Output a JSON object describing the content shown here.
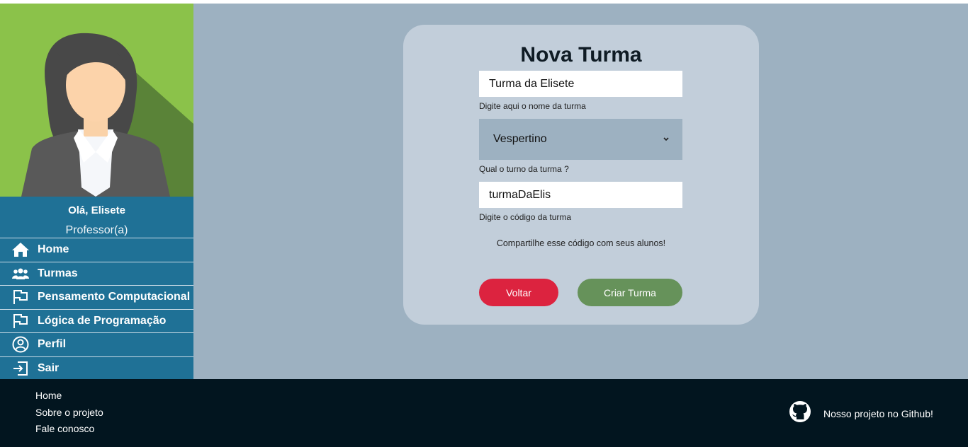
{
  "sidebar": {
    "greeting": "Olá, Elisete",
    "role": "Professor(a)",
    "items": [
      {
        "label": "Home",
        "icon": "home-icon"
      },
      {
        "label": "Turmas",
        "icon": "users-icon"
      },
      {
        "label": "Pensamento Computacional",
        "icon": "flag-icon"
      },
      {
        "label": "Lógica de Programação",
        "icon": "flag-icon"
      },
      {
        "label": "Perfil",
        "icon": "user-circle-icon"
      },
      {
        "label": "Sair",
        "icon": "logout-icon"
      }
    ]
  },
  "form": {
    "title": "Nova Turma",
    "name_value": "Turma da Elisete",
    "name_hint": "Digite aqui o nome da turma",
    "shift_value": "Vespertino",
    "shift_hint": "Qual o turno da turma ?",
    "code_value": "turmaDaElis",
    "code_hint": "Digite o código da turma",
    "share_note": "Compartilhe esse código com seus alunos!",
    "back_label": "Voltar",
    "create_label": "Criar Turma"
  },
  "footer": {
    "links": [
      "Home",
      "Sobre o projeto",
      "Fale conosco"
    ],
    "github_label": "Nosso projeto no Github!"
  },
  "colors": {
    "sidebar": "#1f7196",
    "content_bg": "#9db1c1",
    "card_bg": "#c2ceda",
    "back_button": "#dc233f",
    "create_button": "#66925a",
    "footer": "#02151f"
  }
}
